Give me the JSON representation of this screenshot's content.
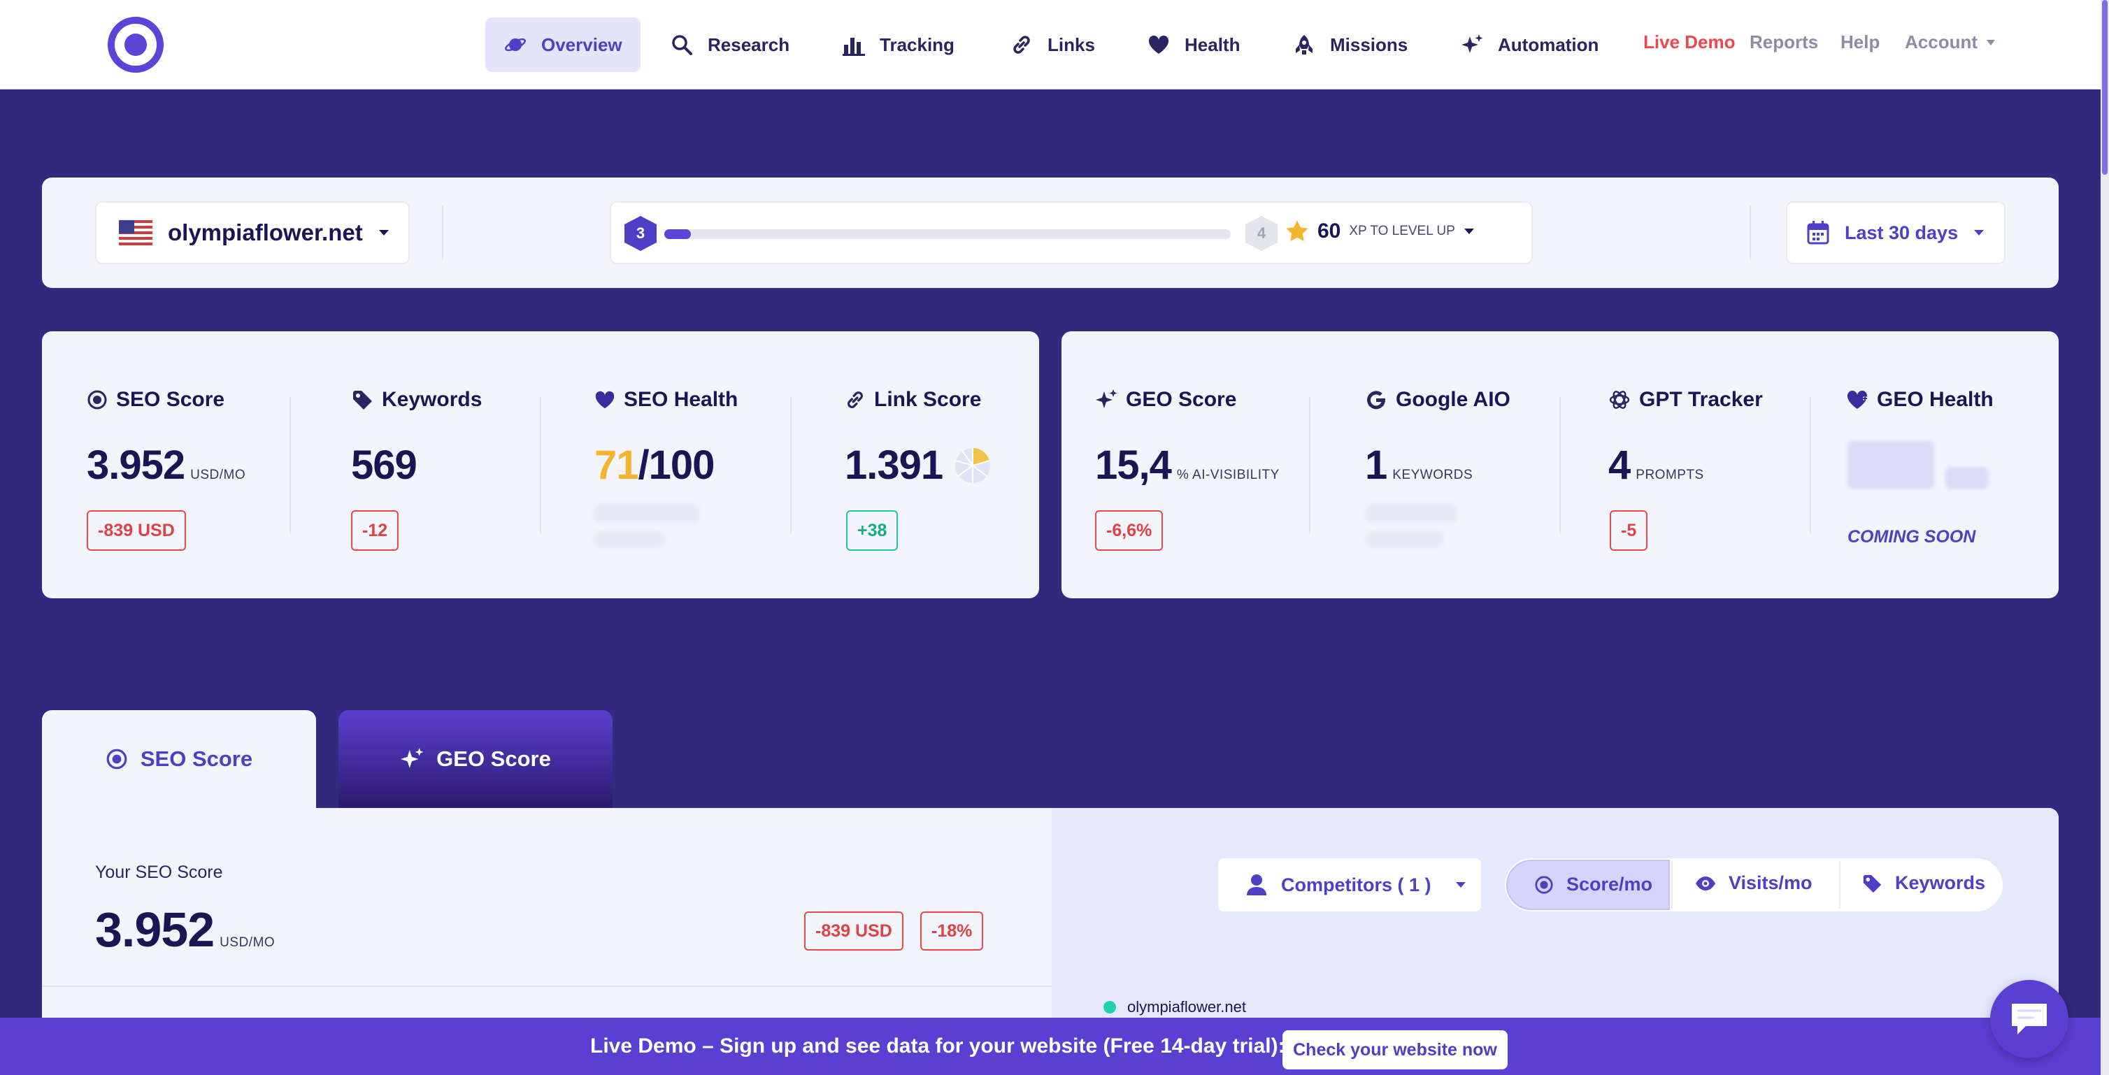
{
  "nav": {
    "items": [
      {
        "label": "Overview",
        "icon": "planet-icon"
      },
      {
        "label": "Research",
        "icon": "search-icon"
      },
      {
        "label": "Tracking",
        "icon": "bar-chart-icon"
      },
      {
        "label": "Links",
        "icon": "link-icon"
      },
      {
        "label": "Health",
        "icon": "heart-icon"
      },
      {
        "label": "Missions",
        "icon": "rocket-icon"
      },
      {
        "label": "Automation",
        "icon": "sparkles-icon"
      }
    ],
    "live_demo": "Live Demo",
    "reports": "Reports",
    "help": "Help",
    "account": "Account"
  },
  "toolbar": {
    "domain": "olympiaflower.net",
    "level_current": "3",
    "level_next": "4",
    "xp_value": "60",
    "xp_label": "XP TO LEVEL UP",
    "xp_progress": 0.04,
    "date_range": "Last 30 days"
  },
  "seo_kpis": [
    {
      "label": "SEO Score",
      "value": "3.952",
      "unit": "USD/MO",
      "delta": "-839 USD"
    },
    {
      "label": "Keywords",
      "value": "569",
      "delta": "-12"
    },
    {
      "label": "SEO Health",
      "value_highlight": "71",
      "value_rest": "/100"
    },
    {
      "label": "Link Score",
      "value": "1.391",
      "delta": "+38"
    }
  ],
  "geo_kpis": [
    {
      "label": "GEO Score",
      "value": "15,4",
      "unit": "% AI-VISIBILITY",
      "delta": "-6,6%"
    },
    {
      "label": "Google AIO",
      "value": "1",
      "unit": "KEYWORDS"
    },
    {
      "label": "GPT Tracker",
      "value": "4",
      "unit": "PROMPTS",
      "delta": "-5"
    },
    {
      "label": "GEO Health",
      "coming_soon": "COMING SOON"
    }
  ],
  "tabs": [
    {
      "label": "SEO Score"
    },
    {
      "label": "GEO Score"
    }
  ],
  "seo_panel": {
    "title": "Your SEO Score",
    "value": "3.952",
    "unit": "USD/MO",
    "delta_usd": "-839 USD",
    "delta_pct": "-18%"
  },
  "chart_controls": {
    "competitors": "Competitors ( 1 )",
    "score": "Score/mo",
    "visits": "Visits/mo",
    "keywords": "Keywords"
  },
  "legend": {
    "domain": "olympiaflower.net"
  },
  "banner": {
    "text": "Live Demo – Sign up and see data for your website (Free 14-day trial):",
    "cta": "Check your website now"
  },
  "colors": {
    "brand": "#5b45d6",
    "background": "#33297f",
    "danger": "#e5484d",
    "success": "#24c98f",
    "highlight": "#f3b52e",
    "live_demo": "#f0464d"
  }
}
